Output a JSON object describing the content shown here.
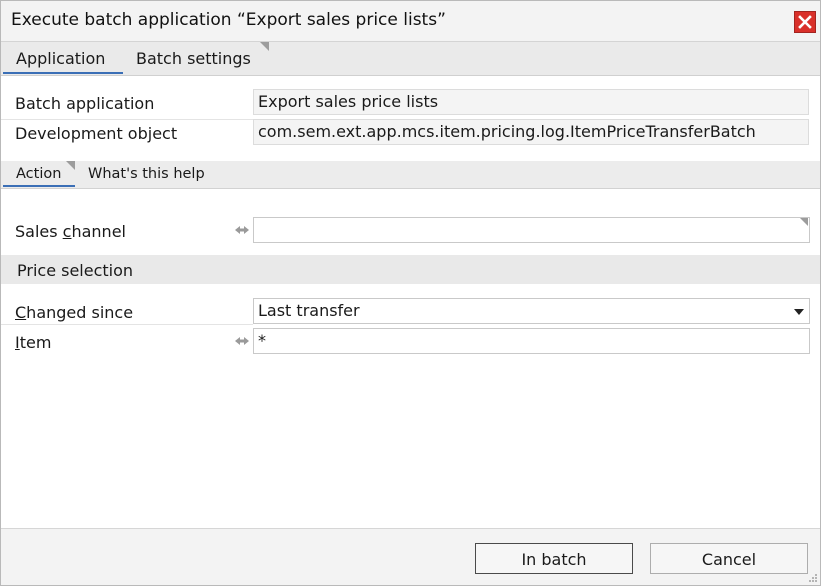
{
  "window": {
    "title": "Execute batch application “Export sales price lists”"
  },
  "tabs": [
    {
      "label": "Application",
      "active": true
    },
    {
      "label": "Batch settings",
      "active": false
    }
  ],
  "info": {
    "batch_application": {
      "label": "Batch application",
      "value": "Export sales price lists"
    },
    "development_object": {
      "label": "Development object",
      "value": "com.sem.ext.app.mcs.item.pricing.log.ItemPriceTransferBatch"
    }
  },
  "subtabs": [
    {
      "label": "Action",
      "active": true
    },
    {
      "label": "What's this help",
      "active": false
    }
  ],
  "sales_channel": {
    "label_pre": "Sales ",
    "label_key": "c",
    "label_post": "hannel",
    "value": ""
  },
  "price_selection": {
    "header": "Price selection"
  },
  "changed_since": {
    "label_key": "C",
    "label_post": "hanged since",
    "value": "Last transfer"
  },
  "item": {
    "label_key": "I",
    "label_post": "tem",
    "value": "*"
  },
  "buttons": {
    "in_batch": "In batch",
    "cancel": "Cancel"
  },
  "icons": {
    "close": "close-icon",
    "link": "link-arrows-icon",
    "dropdown": "chevron-down-icon"
  },
  "colors": {
    "accent_tab": "#3b6fb6",
    "close_red": "#d9302a"
  }
}
